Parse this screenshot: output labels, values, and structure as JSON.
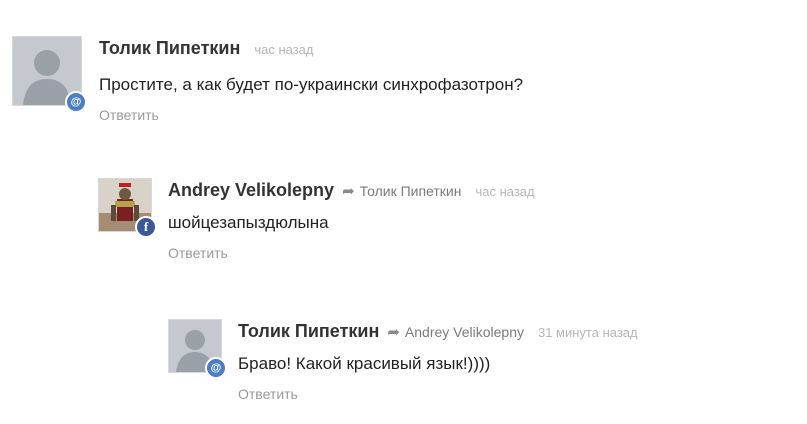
{
  "comments": [
    {
      "author": "Толик Пипеткин",
      "reply_to": "",
      "time": "час назад",
      "text": "Простите, а как будет по-украински синхрофазотрон?",
      "action": "Ответить",
      "badge_icon": "at-icon",
      "badge_glyph": "@"
    },
    {
      "author": "Andrey Velikolepny",
      "reply_to": "Толик Пипеткин",
      "time": "час назад",
      "text": "шойцезапыздюлына",
      "action": "Ответить",
      "badge_icon": "facebook-icon",
      "badge_glyph": "f"
    },
    {
      "author": "Толик Пипеткин",
      "reply_to": "Andrey Velikolepny",
      "time": "31 минута назад",
      "text": "Браво! Какой красивый язык!))))",
      "action": "Ответить",
      "badge_icon": "at-icon",
      "badge_glyph": "@"
    }
  ],
  "icons": {
    "reply_arrow": "reply-arrow-icon"
  },
  "colors": {
    "badge_at": "#4a7fc1",
    "badge_fb": "#3b5998",
    "link": "#9a9a9a",
    "time": "#b5b5b5"
  }
}
